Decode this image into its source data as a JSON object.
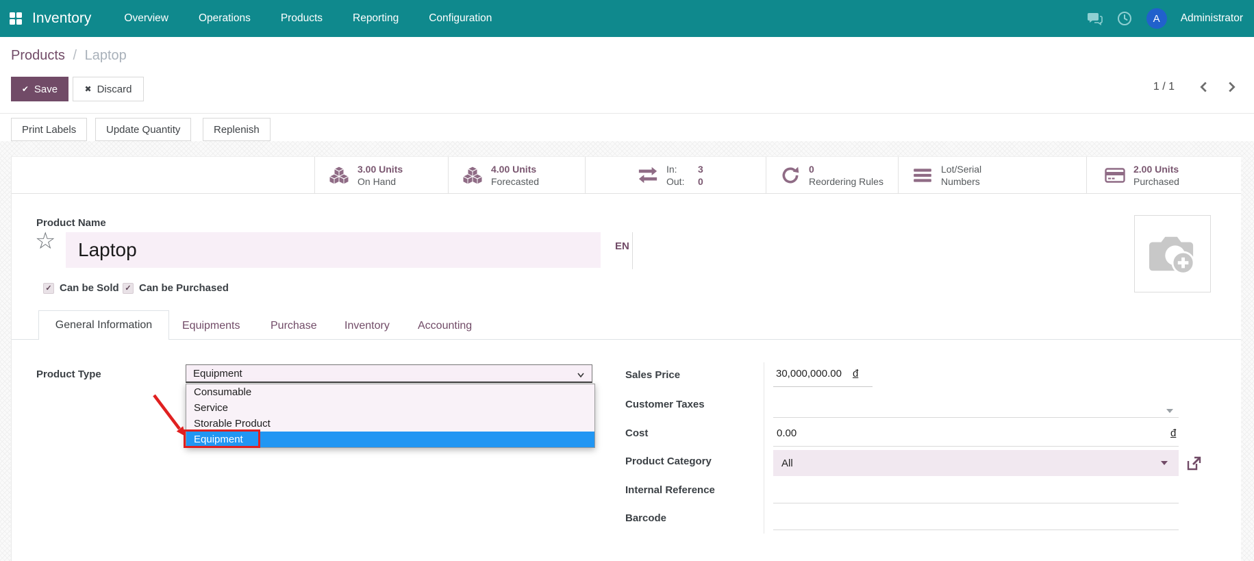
{
  "colors": {
    "nav_teal": "#0f898d",
    "primary_purple": "#714B67",
    "highlight_blue": "#2196f3",
    "annotation_red": "#e02020",
    "field_pink": "#f8eff7"
  },
  "icons": {
    "save_check": "✔",
    "discard_x": "✖",
    "star": "☆",
    "check": "✓"
  },
  "nav": {
    "app_name": "Inventory",
    "menus": [
      "Overview",
      "Operations",
      "Products",
      "Reporting",
      "Configuration"
    ],
    "avatar_initial": "A",
    "user": "Administrator"
  },
  "breadcrumb": {
    "parent": "Products",
    "separator": "/",
    "current": "Laptop"
  },
  "control_panel": {
    "save_label": "Save",
    "discard_label": "Discard",
    "pager": "1 / 1",
    "action_buttons": [
      "Print Labels",
      "Update Quantity",
      "Replenish"
    ]
  },
  "stat_buttons": [
    {
      "icon": "cubes-icon",
      "line1": "3.00 Units",
      "line2": "On Hand"
    },
    {
      "icon": "cubes-icon",
      "line1": "4.00 Units",
      "line2": "Forecasted"
    },
    {
      "icon": "transfer-icon",
      "rows": [
        {
          "label": "In:",
          "value": "3"
        },
        {
          "label": "Out:",
          "value": "0"
        }
      ]
    },
    {
      "icon": "refresh-icon",
      "line1": "0",
      "line2": "Reordering Rules"
    },
    {
      "icon": "list-icon",
      "line1": "Lot/Serial",
      "line2": "Numbers"
    },
    {
      "icon": "credit-card-icon",
      "line1": "2.00 Units",
      "line2": "Purchased"
    }
  ],
  "product": {
    "name_label": "Product Name",
    "name_value": "Laptop",
    "lang_badge": "EN",
    "checkboxes": [
      {
        "label": "Can be Sold",
        "checked": true
      },
      {
        "label": "Can be Purchased",
        "checked": true
      }
    ]
  },
  "tabs": {
    "items": [
      "General Information",
      "Equipments",
      "Purchase",
      "Inventory",
      "Accounting"
    ],
    "active": "General Information"
  },
  "product_type": {
    "label": "Product Type",
    "selected": "Equipment",
    "options": [
      "Consumable",
      "Service",
      "Storable Product",
      "Equipment"
    ],
    "highlighted_option": "Equipment"
  },
  "fields": {
    "sales_price": {
      "label": "Sales Price",
      "value": "30,000,000.00",
      "currency": "đ"
    },
    "customer_taxes": {
      "label": "Customer Taxes",
      "value": ""
    },
    "cost": {
      "label": "Cost",
      "value": "0.00",
      "currency": "đ"
    },
    "product_category": {
      "label": "Product Category",
      "value": "All"
    },
    "internal_reference": {
      "label": "Internal Reference",
      "value": ""
    },
    "barcode": {
      "label": "Barcode",
      "value": ""
    }
  }
}
